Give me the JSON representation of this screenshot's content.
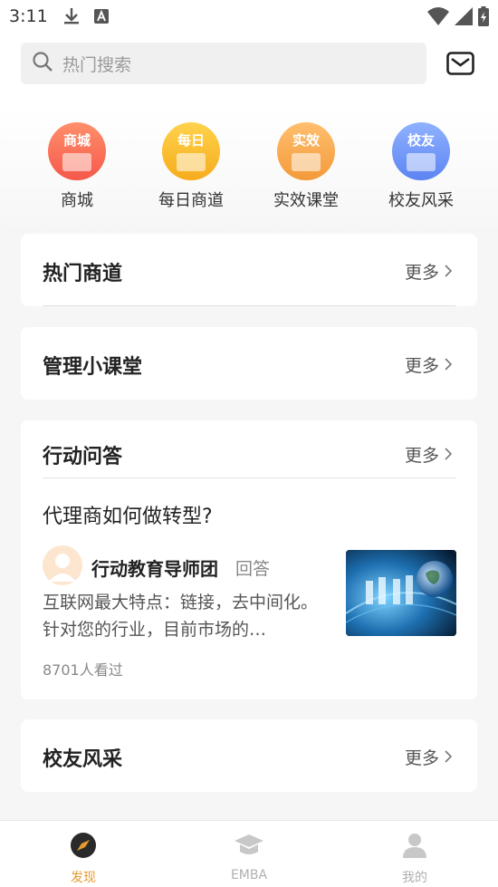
{
  "status_bar": {
    "time": "3:11"
  },
  "search": {
    "placeholder": "热门搜索"
  },
  "categories": [
    {
      "icon_text": "商城",
      "label": "商城",
      "colors": [
        "#ff8f6b",
        "#f5584a"
      ]
    },
    {
      "icon_text": "每日",
      "label": "每日商道",
      "colors": [
        "#ffd24d",
        "#f6ac1c"
      ]
    },
    {
      "icon_text": "实效",
      "label": "实效课堂",
      "colors": [
        "#ffbf6e",
        "#f39a3a"
      ]
    },
    {
      "icon_text": "校友",
      "label": "校友风采",
      "colors": [
        "#8fb2ff",
        "#5c84f2"
      ]
    }
  ],
  "sections": {
    "hot": {
      "title": "热门商道",
      "more": "更多"
    },
    "class": {
      "title": "管理小课堂",
      "more": "更多"
    },
    "qa": {
      "title": "行动问答",
      "more": "更多",
      "question": "代理商如何做转型?",
      "author": "行动教育导师团",
      "tag": "回答",
      "snippet": "互联网最大特点：链接，去中间化。针对您的行业，目前市场的…",
      "views": "8701人看过"
    },
    "alumni": {
      "title": "校友风采",
      "more": "更多"
    }
  },
  "bottom_nav": [
    {
      "label": "发现",
      "active": true
    },
    {
      "label": "EMBA",
      "active": false
    },
    {
      "label": "我的",
      "active": false
    }
  ],
  "colors": {
    "accent": "#e69a2e",
    "inactive": "#b0b0b0"
  }
}
